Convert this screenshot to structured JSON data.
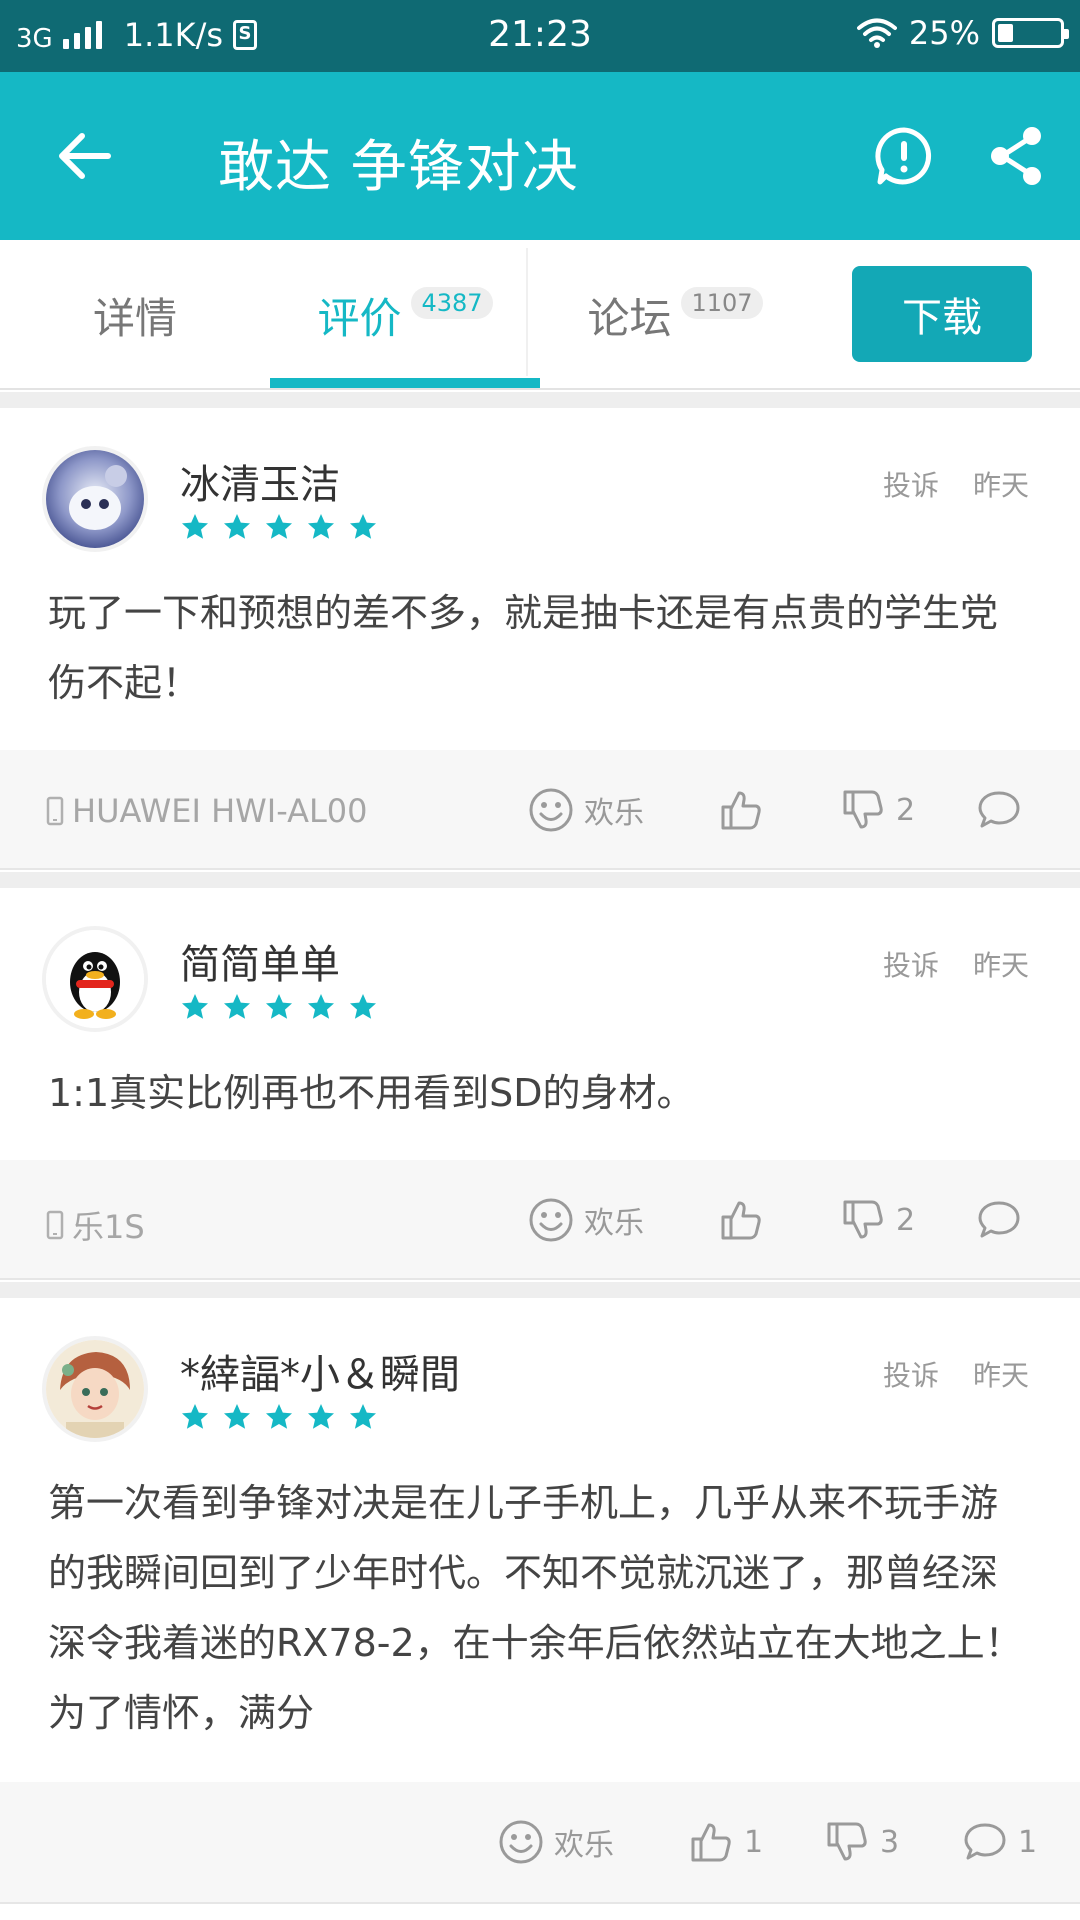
{
  "status_bar": {
    "network": "3G",
    "speed": "1.1K/s",
    "sim": "S",
    "time": "21:23",
    "battery": "25%",
    "battery_level": 0.25
  },
  "app_bar": {
    "title": "敢达 争锋对决"
  },
  "tabs": [
    {
      "label": "详情",
      "count": ""
    },
    {
      "label": "评价",
      "count": "4387"
    },
    {
      "label": "论坛",
      "count": "1107"
    }
  ],
  "download_label": "下载",
  "colors": {
    "accent": "#15b8c5",
    "status_bar": "#0f6a73",
    "star": "#15b8c5"
  },
  "reviews": [
    {
      "username": "冰清玉洁",
      "stars": 5,
      "report_label": "投诉",
      "date": "昨天",
      "content": "玩了一下和预想的差不多，就是抽卡还是有点贵的学生党伤不起！",
      "device": "HUAWEI HWI-AL00",
      "mood": "欢乐",
      "likes": "",
      "dislikes": "2",
      "comments": ""
    },
    {
      "username": "简简单单",
      "stars": 5,
      "report_label": "投诉",
      "date": "昨天",
      "content": "1:1真实比例再也不用看到SD的身材。",
      "device": "乐1S",
      "mood": "欢乐",
      "likes": "",
      "dislikes": "2",
      "comments": ""
    },
    {
      "username": "*緈諨*小＆瞬間",
      "stars": 5,
      "report_label": "投诉",
      "date": "昨天",
      "content": "第一次看到争锋对决是在儿子手机上，几乎从来不玩手游的我瞬间回到了少年时代。不知不觉就沉迷了，那曾经深深令我着迷的RX78-2，在十余年后依然站立在大地之上！为了情怀，满分",
      "device": "",
      "mood": "欢乐",
      "likes": "1",
      "dislikes": "3",
      "comments": "1"
    }
  ]
}
